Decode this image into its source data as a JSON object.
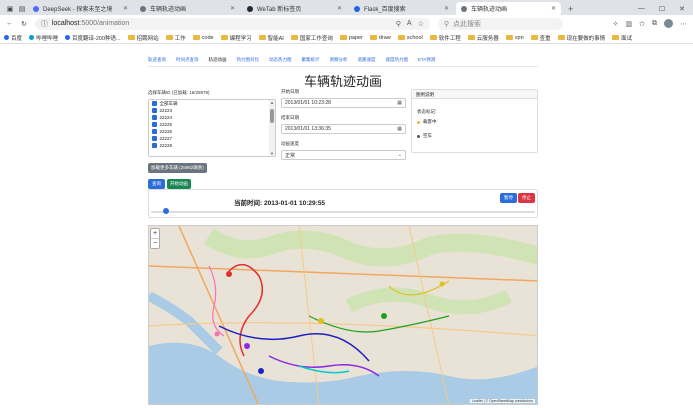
{
  "browser": {
    "tabs": [
      {
        "title": "DeepSeek - 探索未至之境",
        "color": "#4d6bfe",
        "active": false
      },
      {
        "title": "车辆轨迹动画",
        "color": "#6b7280",
        "active": false
      },
      {
        "title": "WeTab 新标签页",
        "color": "#1f2937",
        "active": false
      },
      {
        "title": "Flask_百度搜索",
        "color": "#2563eb",
        "active": false
      },
      {
        "title": "车辆轨迹动画",
        "color": "#6b7280",
        "active": true
      }
    ],
    "new_tab": "+",
    "url_host": "localhost",
    "url_path": ":5000/animation",
    "search_placeholder": "点此搜索",
    "bookmarks": [
      "百度",
      "哔哩哔哩",
      "百度翻译-200种语...",
      "招聘网站",
      "工作",
      "code",
      "编程学习",
      "智能AI",
      "国家工作查询",
      "paper",
      "draw",
      "school",
      "软件工程",
      "云服务器",
      "vpn",
      "查重",
      "现在要做的事情",
      "面试"
    ]
  },
  "app": {
    "nav": [
      "轨迹查询",
      "时间点查询",
      "轨迹动画",
      "热力图对比",
      "动态热力图",
      "聚集统计",
      "洞察分析",
      "道路速度",
      "速度热力图",
      "ETA预测"
    ],
    "active_nav": "轨迹动画",
    "title": "车辆轨迹动画",
    "vehicle_label": "选择车辆ID (已加载: 16/25978)",
    "vehicles": [
      "全部车辆",
      "22223",
      "22224",
      "22225",
      "22226",
      "22227",
      "22228"
    ],
    "load_more": "加载更多车辆 (25962辆余)",
    "start_label": "开始日期",
    "start_value": "2013/01/01 10:23:28",
    "end_label": "结束日期",
    "end_value": "2013/01/01 13:36:35",
    "speed_label": "动画速度",
    "speed_value": "正常",
    "legend_title": "图例说明",
    "legend_sub": "状态标记:",
    "legend_items": [
      {
        "label": "载客中",
        "color": "#e9b93d"
      },
      {
        "label": "空车",
        "color": "#555555"
      }
    ],
    "query_btn": "查询",
    "start_btn": "开始动画",
    "current_time": "当前时间: 2013-01-01 10:29:55",
    "pause_btn": "暂停",
    "stop_btn": "停止",
    "progress": 0.04,
    "map_zoom_in": "+",
    "map_zoom_out": "−",
    "map_attr": "Leaflet | © OpenStreetMap contributors"
  }
}
